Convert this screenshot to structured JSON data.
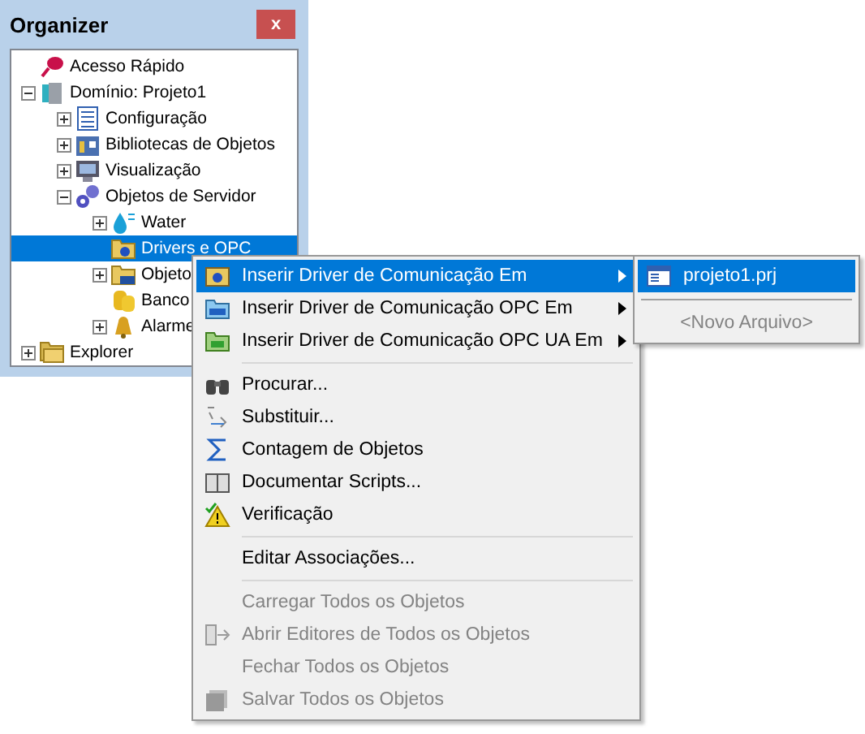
{
  "panel": {
    "title": "Organizer",
    "close": "x"
  },
  "tree": [
    {
      "label": "Acesso Rápido",
      "kind": "pin",
      "selected": false
    },
    {
      "label": "Domínio: Projeto1",
      "kind": "domain",
      "expanded": true,
      "selected": false,
      "children": [
        {
          "label": "Configuração",
          "kind": "list",
          "expanded": false,
          "selected": false
        },
        {
          "label": "Bibliotecas de Objetos",
          "kind": "library",
          "expanded": false,
          "selected": false
        },
        {
          "label": "Visualização",
          "kind": "monitor",
          "expanded": false,
          "selected": false
        },
        {
          "label": "Objetos de Servidor",
          "kind": "gears",
          "expanded": true,
          "selected": false,
          "children": [
            {
              "label": "Water",
              "kind": "drop",
              "expanded": false,
              "selected": false
            },
            {
              "label": "Drivers e OPC",
              "kind": "folder",
              "selected": true
            },
            {
              "label": "Objeto",
              "kind": "datafolder",
              "expanded": false,
              "selected": false
            },
            {
              "label": "Banco",
              "kind": "database",
              "selected": false
            },
            {
              "label": "Alarme",
              "kind": "bell",
              "expanded": false,
              "selected": false
            }
          ]
        }
      ]
    },
    {
      "label": "Explorer",
      "kind": "folders",
      "expanded": false,
      "selected": false
    }
  ],
  "menu": [
    [
      {
        "label": "Inserir Driver de Comunicação Em",
        "kind": "driver",
        "submenu": true,
        "selected": true,
        "disabled": false
      },
      {
        "label": "Inserir Driver de Comunicação OPC Em",
        "kind": "opc",
        "submenu": true,
        "selected": false,
        "disabled": false
      },
      {
        "label": "Inserir Driver de Comunicação OPC UA Em",
        "kind": "ua",
        "submenu": true,
        "selected": false,
        "disabled": false
      }
    ],
    [
      {
        "label": "Procurar...",
        "kind": "binoculars",
        "selected": false,
        "disabled": false
      },
      {
        "label": "Substituir...",
        "kind": "replace",
        "selected": false,
        "disabled": false
      },
      {
        "label": "Contagem de Objetos",
        "kind": "sigma",
        "selected": false,
        "disabled": false
      },
      {
        "label": "Documentar Scripts...",
        "kind": "book",
        "selected": false,
        "disabled": false
      },
      {
        "label": "Verificação",
        "kind": "warning",
        "selected": false,
        "disabled": false
      }
    ],
    [
      {
        "label": "Editar Associações...",
        "kind": "none",
        "selected": false,
        "disabled": false
      }
    ],
    [
      {
        "label": "Carregar Todos os Objetos",
        "kind": "none",
        "selected": false,
        "disabled": true
      },
      {
        "label": "Abrir Editores de Todos os Objetos",
        "kind": "editors",
        "selected": false,
        "disabled": true
      },
      {
        "label": "Fechar Todos os Objetos",
        "kind": "none",
        "selected": false,
        "disabled": true
      },
      {
        "label": "Salvar Todos os Objetos",
        "kind": "save",
        "selected": false,
        "disabled": true
      }
    ]
  ],
  "submenu": [
    {
      "label": "projeto1.prj",
      "kind": "file",
      "selected": true,
      "disabled": false
    },
    {
      "label": "<Novo Arquivo>",
      "kind": "new",
      "selected": false,
      "disabled": true
    }
  ]
}
